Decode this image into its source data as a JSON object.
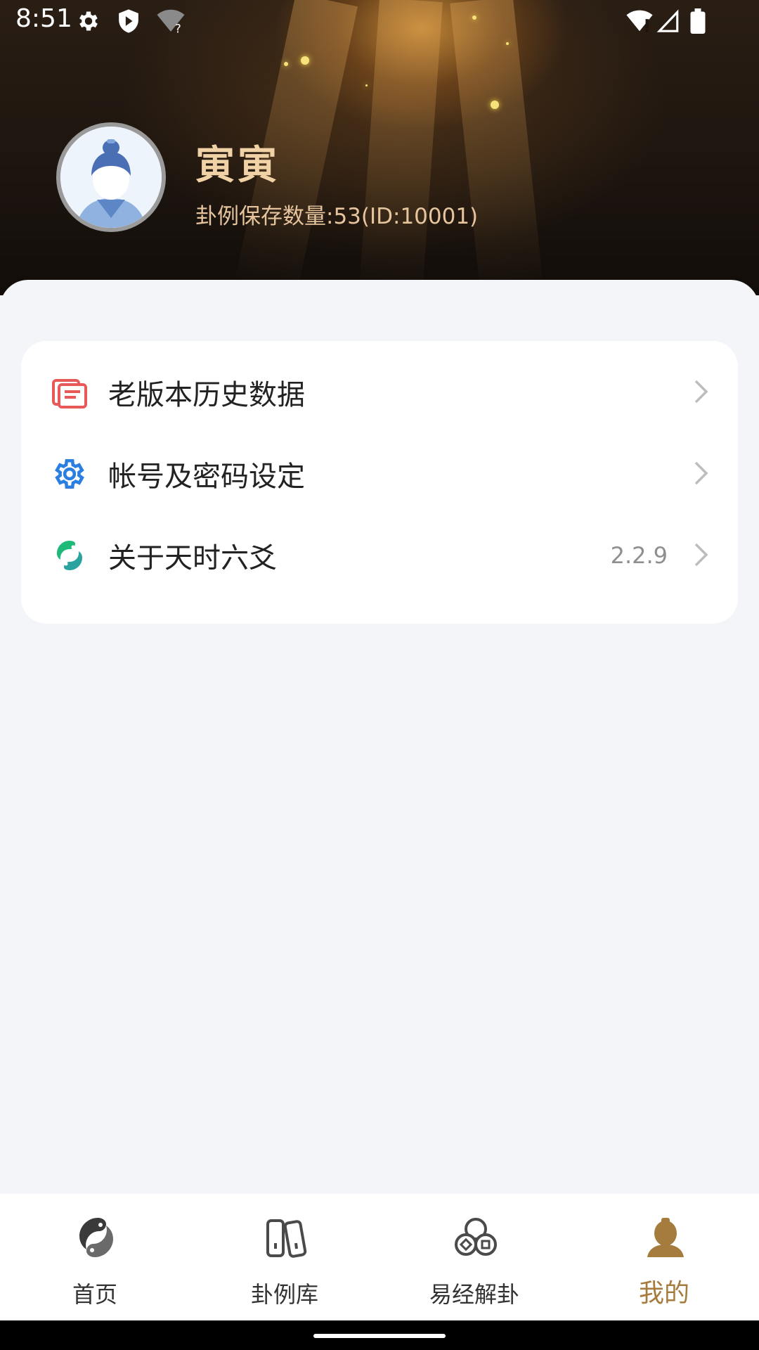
{
  "status_bar": {
    "time": "8:51",
    "icons": [
      "settings-icon",
      "shield-icon",
      "wifi-unknown-icon",
      "wifi-icon",
      "signal-icon",
      "battery-icon"
    ]
  },
  "profile": {
    "name": "寅寅",
    "subtitle": "卦例保存数量:53(ID:10001)"
  },
  "menu": {
    "items": [
      {
        "label": "老版本历史数据",
        "icon": "history-data-icon",
        "accent": "#e85a5a"
      },
      {
        "label": "帐号及密码设定",
        "icon": "gear-icon",
        "accent": "#2b7fe0"
      },
      {
        "label": "关于天时六爻",
        "icon": "app-logo-icon",
        "accent": "#1fb97a",
        "value": "2.2.9"
      }
    ]
  },
  "bottom_nav": {
    "items": [
      {
        "label": "首页",
        "icon": "home-taiji-icon"
      },
      {
        "label": "卦例库",
        "icon": "books-icon"
      },
      {
        "label": "易经解卦",
        "icon": "coins-icon"
      },
      {
        "label": "我的",
        "icon": "profile-icon",
        "active": true
      }
    ],
    "active_color": "#a67c3e"
  }
}
